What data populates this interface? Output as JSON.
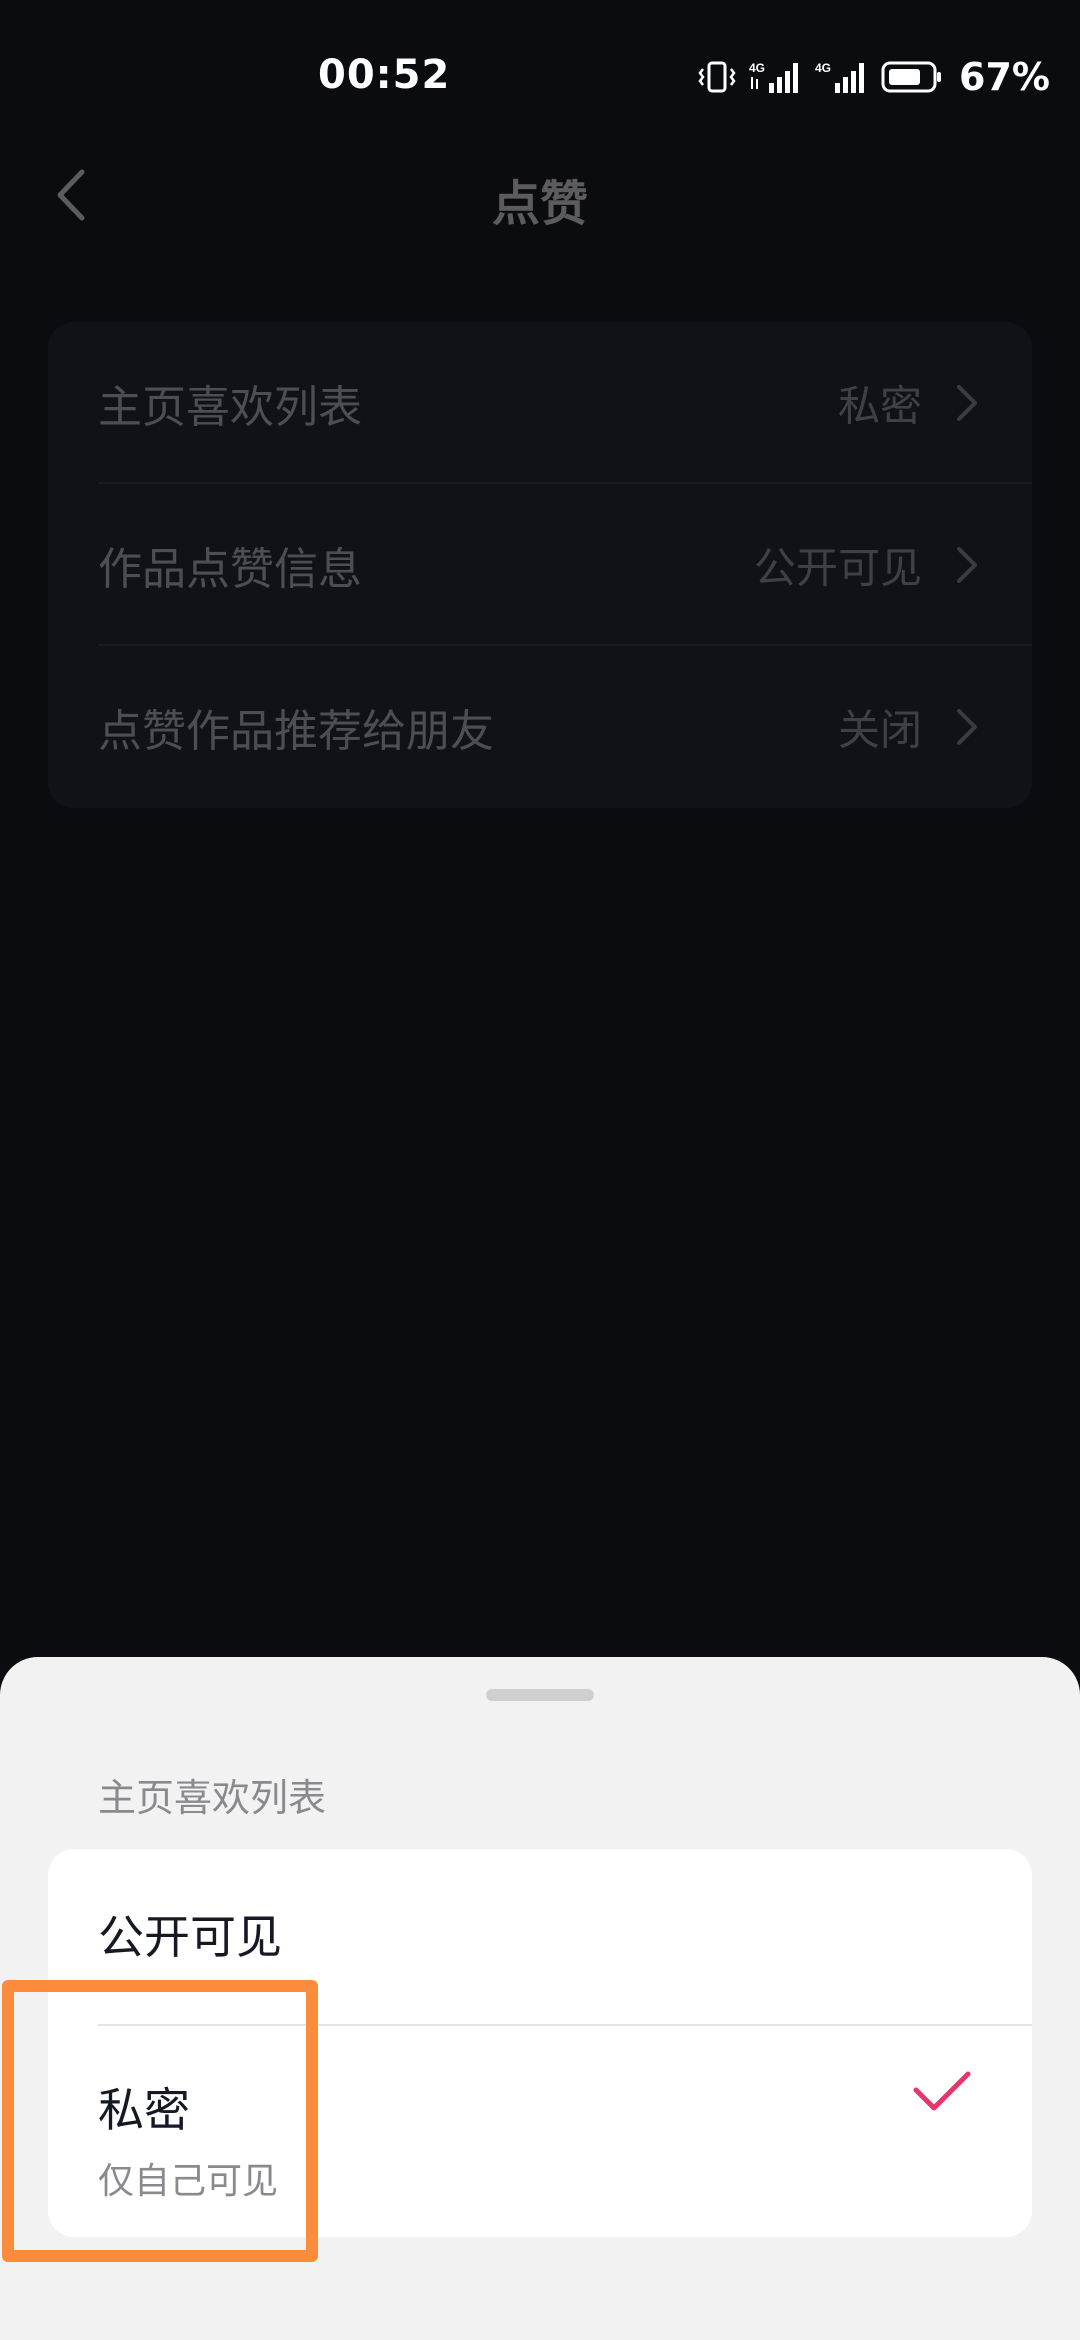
{
  "status_bar": {
    "time": "00:52",
    "battery_percent": "67%",
    "network_1": "4G",
    "network_2": "4G"
  },
  "header": {
    "title": "点赞",
    "back_icon": "chevron-left-icon"
  },
  "settings": {
    "rows": [
      {
        "label": "主页喜欢列表",
        "value": "私密"
      },
      {
        "label": "作品点赞信息",
        "value": "公开可见"
      },
      {
        "label": "点赞作品推荐给朋友",
        "value": "关闭"
      }
    ]
  },
  "sheet": {
    "title": "主页喜欢列表",
    "options": [
      {
        "label": "公开可见",
        "sub": "",
        "selected": false
      },
      {
        "label": "私密",
        "sub": "仅自己可见",
        "selected": true
      }
    ],
    "check_color": "#e6366b",
    "highlight_color": "#fb8c3b"
  }
}
